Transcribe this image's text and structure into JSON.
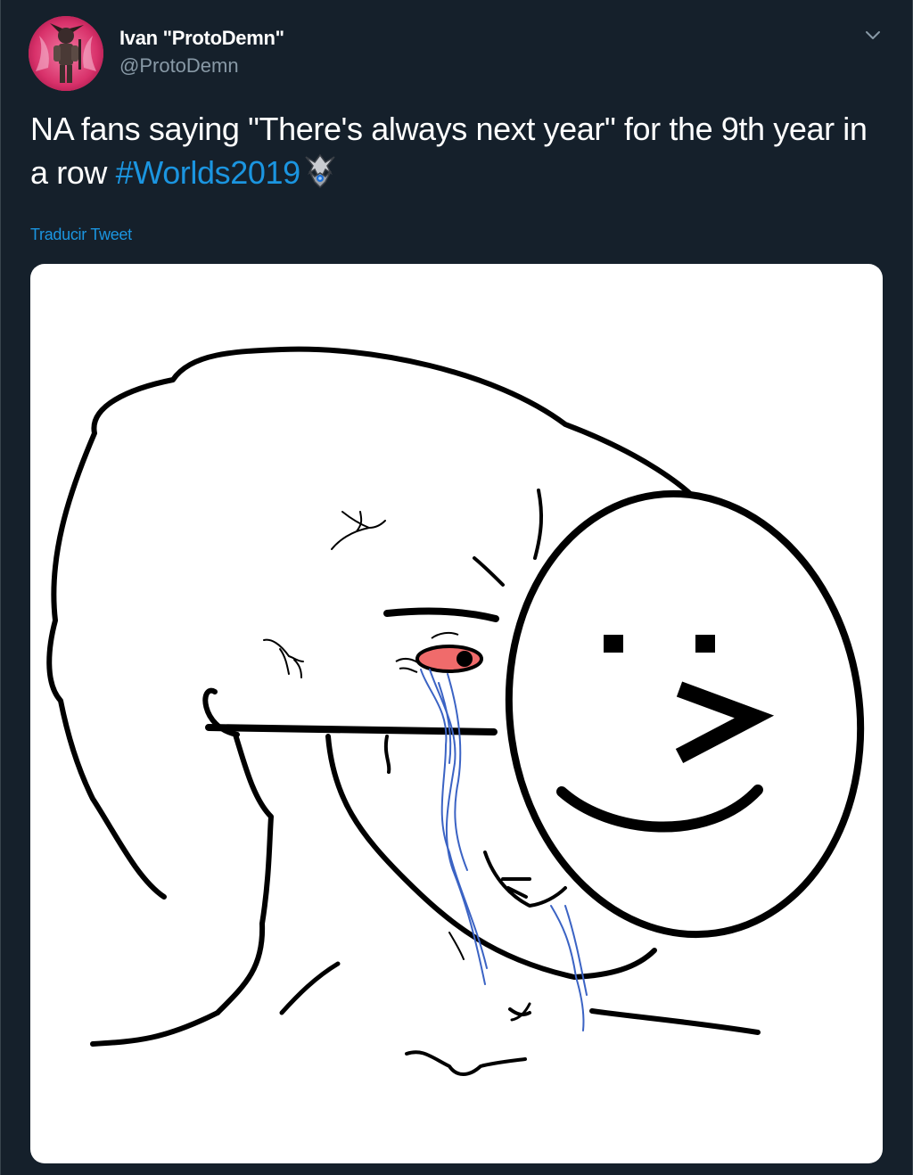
{
  "author": {
    "display_name": "Ivan \"ProtoDemn\"",
    "handle": "@ProtoDemn",
    "avatar_icon": "avatar-image"
  },
  "tweet": {
    "text_before": "NA fans saying \"There's always next year\" for the 9th year in a row ",
    "hashtag": "#Worlds2019",
    "emoji_icon": "worlds-trophy-icon",
    "translate_label": "Traducir Tweet"
  },
  "menu": {
    "icon": "chevron-down-icon"
  },
  "media": {
    "type": "image",
    "description_icon": "crying-wojak-smiley-mask-meme"
  },
  "colors": {
    "background": "#15202b",
    "text": "#ffffff",
    "secondary_text": "#8899a6",
    "link": "#1b95e0",
    "border": "#38444d"
  }
}
